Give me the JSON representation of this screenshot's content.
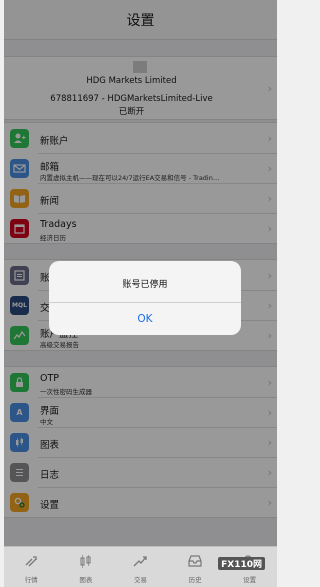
{
  "header": {
    "title": "设置"
  },
  "account": {
    "broker": "HDG Markets Limited",
    "login": "678811697 - HDGMarketsLimited-Live",
    "status": "已断开"
  },
  "menu": {
    "new_account": {
      "title": "新账户",
      "icon": "add-person-icon",
      "color": "#34c759"
    },
    "mailbox": {
      "title": "邮箱",
      "subtitle": "内置虚拟主机——现在可以24/7运行EA交易和信号 - Tradin…",
      "icon": "mail-icon",
      "color": "#4a90e2"
    },
    "news": {
      "title": "新闻",
      "icon": "book-icon",
      "color": "#f5a623"
    },
    "tradays": {
      "title": "Tradays",
      "subtitle": "经济日历",
      "icon": "calendar-icon",
      "color": "#d0021b"
    },
    "accounts": {
      "title": "账户",
      "icon": "account-icon",
      "color": "#6b6b8a"
    },
    "trading": {
      "title": "交易",
      "icon": "mql-icon",
      "color": "#2a4a7f"
    },
    "report": {
      "title": "账户监控",
      "subtitle": "高级交易报告",
      "icon": "chart-line-icon",
      "color": "#34c759"
    },
    "otp": {
      "title": "OTP",
      "subtitle": "一次性密码生成器",
      "icon": "lock-icon",
      "color": "#34c759"
    },
    "interface": {
      "title": "界面",
      "subtitle": "中文",
      "icon": "language-icon",
      "color": "#4a90e2"
    },
    "charts": {
      "title": "图表",
      "icon": "candles-icon",
      "color": "#4a90e2"
    },
    "journal": {
      "title": "日志",
      "icon": "journal-icon",
      "color": "#8e8e93"
    },
    "settings": {
      "title": "设置",
      "icon": "gears-icon",
      "color": "#f5a623"
    }
  },
  "dialog": {
    "message": "账号已停用",
    "ok_label": "OK"
  },
  "tabs": [
    {
      "label": "行情",
      "icon": "quotes-icon"
    },
    {
      "label": "图表",
      "icon": "chart-tab-icon"
    },
    {
      "label": "交易",
      "icon": "trade-tab-icon"
    },
    {
      "label": "历史",
      "icon": "history-tab-icon"
    },
    {
      "label": "设置",
      "icon": "settings-tab-icon"
    }
  ],
  "watermark": "FX110网",
  "colors": {
    "accent": "#1a6ee6",
    "tab_active": "#1a6ee6"
  }
}
